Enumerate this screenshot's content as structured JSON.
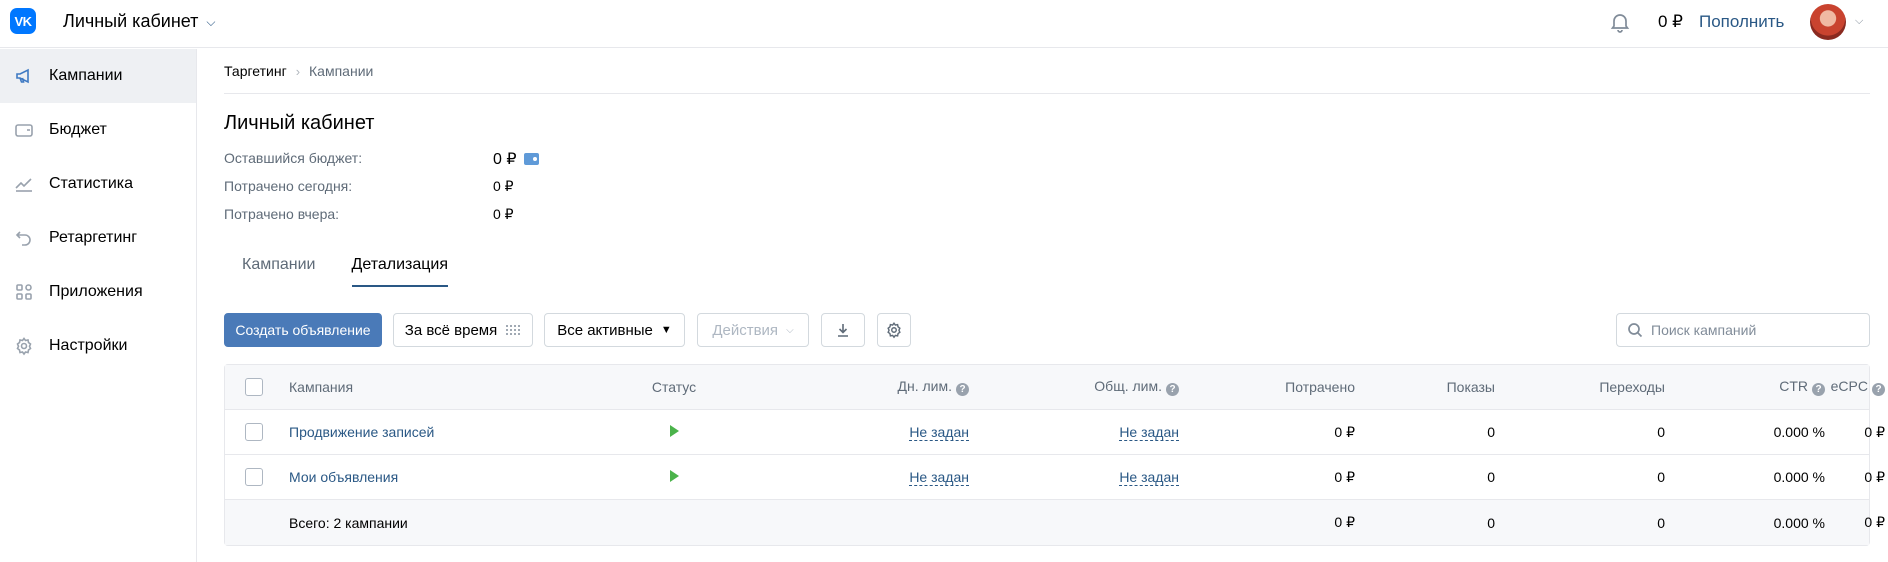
{
  "header": {
    "logo": "VK",
    "cabinet_title": "Личный кабинет",
    "balance": "0 ₽",
    "topup_label": "Пополнить"
  },
  "sidebar": {
    "items": [
      {
        "label": "Кампании",
        "icon": "megaphone-icon",
        "active": true
      },
      {
        "label": "Бюджет",
        "icon": "wallet-icon",
        "active": false
      },
      {
        "label": "Статистика",
        "icon": "chart-icon",
        "active": false
      },
      {
        "label": "Ретаргетинг",
        "icon": "undo-icon",
        "active": false
      },
      {
        "label": "Приложения",
        "icon": "apps-icon",
        "active": false
      },
      {
        "label": "Настройки",
        "icon": "gear-icon",
        "active": false
      }
    ]
  },
  "breadcrumb": {
    "root": "Таргетинг",
    "current": "Кампании"
  },
  "summary": {
    "title": "Личный кабинет",
    "remaining_label": "Оставшийся бюджет:",
    "remaining_value": "0 ₽",
    "today_label": "Потрачено сегодня:",
    "today_value": "0 ₽",
    "yesterday_label": "Потрачено вчера:",
    "yesterday_value": "0 ₽"
  },
  "tabs": [
    {
      "label": "Кампании",
      "active": false
    },
    {
      "label": "Детализация",
      "active": true
    }
  ],
  "toolbar": {
    "create_label": "Создать объявление",
    "period_label": "За всё время",
    "filter_label": "Все активные",
    "actions_label": "Действия",
    "search_placeholder": "Поиск кампаний"
  },
  "table": {
    "columns": {
      "name": "Кампания",
      "status": "Статус",
      "day_limit": "Дн. лим.",
      "total_limit": "Общ. лим.",
      "spent": "Потрачено",
      "shows": "Показы",
      "clicks": "Переходы",
      "ctr": "CTR",
      "ecpc": "eCPC"
    },
    "rows": [
      {
        "name": "Продвижение записей",
        "day_limit": "Не задан",
        "total_limit": "Не задан",
        "spent": "0 ₽",
        "shows": "0",
        "clicks": "0",
        "ctr": "0.000 %",
        "ecpc": "0 ₽"
      },
      {
        "name": "Мои объявления",
        "day_limit": "Не задан",
        "total_limit": "Не задан",
        "spent": "0 ₽",
        "shows": "0",
        "clicks": "0",
        "ctr": "0.000 %",
        "ecpc": "0 ₽"
      }
    ],
    "total": {
      "label": "Всего: 2 кампании",
      "spent": "0 ₽",
      "shows": "0",
      "clicks": "0",
      "ctr": "0.000 %",
      "ecpc": "0 ₽"
    }
  },
  "colors": {
    "accent": "#2a5885",
    "primary_button": "#4a7ab8",
    "status_active": "#4bb34b",
    "vk_blue": "#0077ff"
  }
}
